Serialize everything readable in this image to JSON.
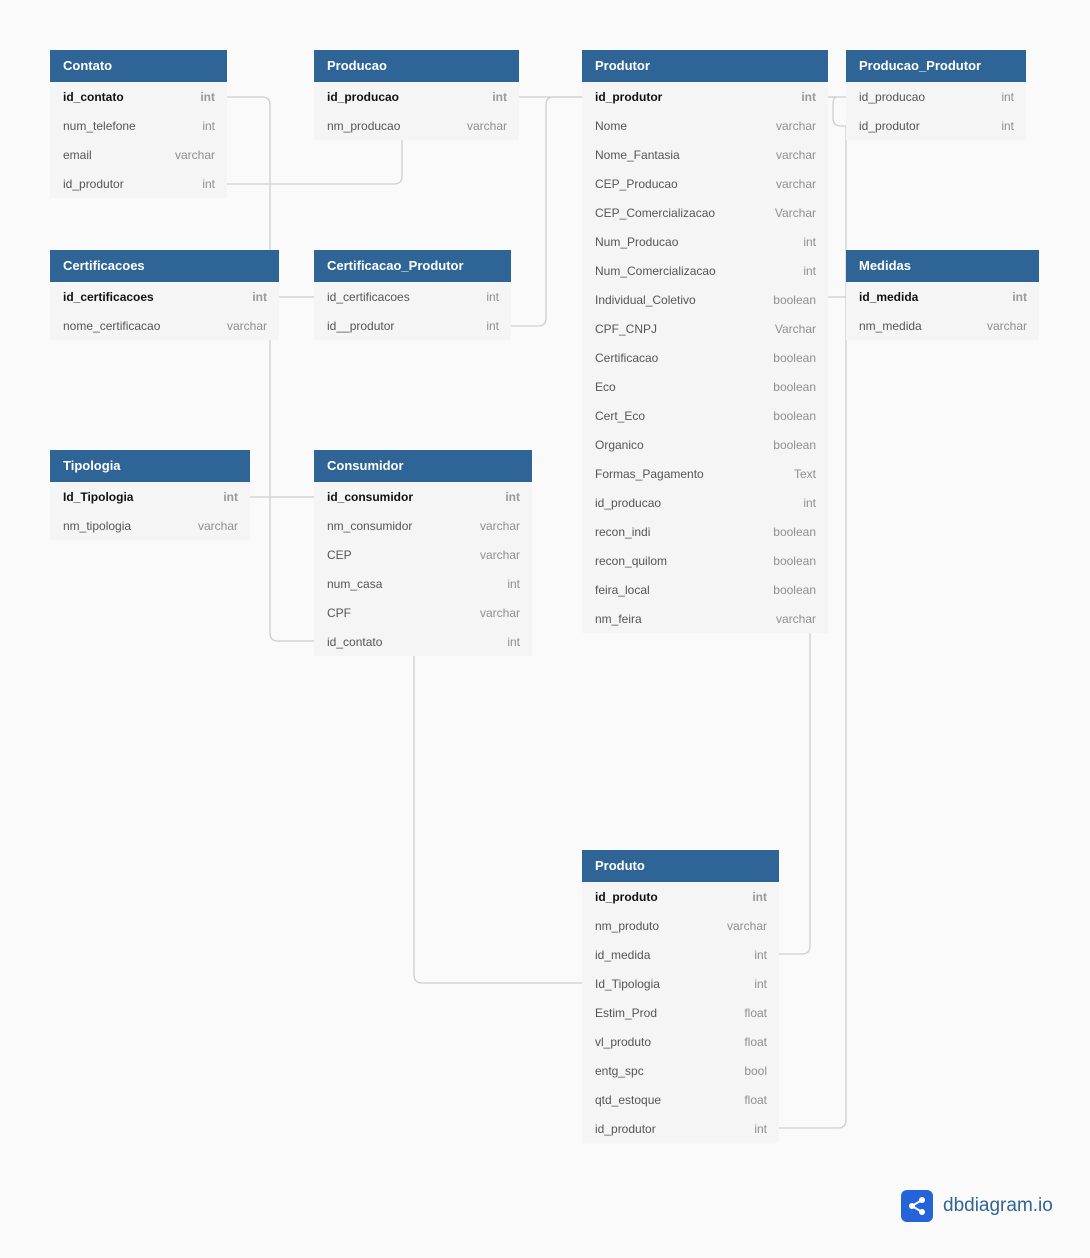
{
  "tables": [
    {
      "name": "Contato",
      "fields": [
        [
          "id_contato",
          "int",
          true
        ],
        [
          "num_telefone",
          "int",
          false
        ],
        [
          "email",
          "varchar",
          false
        ],
        [
          "id_produtor",
          "int",
          false
        ]
      ]
    },
    {
      "name": "Producao",
      "fields": [
        [
          "id_producao",
          "int",
          true
        ],
        [
          "nm_producao",
          "varchar",
          false
        ]
      ]
    },
    {
      "name": "Produtor",
      "fields": [
        [
          "id_produtor",
          "int",
          true
        ],
        [
          "Nome",
          "varchar",
          false
        ],
        [
          "Nome_Fantasia",
          "varchar",
          false
        ],
        [
          "CEP_Producao",
          "varchar",
          false
        ],
        [
          "CEP_Comercializacao",
          "Varchar",
          false
        ],
        [
          "Num_Producao",
          "int",
          false
        ],
        [
          "Num_Comercializacao",
          "int",
          false
        ],
        [
          "Individual_Coletivo",
          "boolean",
          false
        ],
        [
          "CPF_CNPJ",
          "Varchar",
          false
        ],
        [
          "Certificacao",
          "boolean",
          false
        ],
        [
          "Eco",
          "boolean",
          false
        ],
        [
          "Cert_Eco",
          "boolean",
          false
        ],
        [
          "Organico",
          "boolean",
          false
        ],
        [
          "Formas_Pagamento",
          "Text",
          false
        ],
        [
          "id_producao",
          "int",
          false
        ],
        [
          "recon_indi",
          "boolean",
          false
        ],
        [
          "recon_quilom",
          "boolean",
          false
        ],
        [
          "feira_local",
          "boolean",
          false
        ],
        [
          "nm_feira",
          "varchar",
          false
        ]
      ]
    },
    {
      "name": "Producao_Produtor",
      "fields": [
        [
          "id_producao",
          "int",
          false
        ],
        [
          "id_produtor",
          "int",
          false
        ]
      ]
    },
    {
      "name": "Certificacoes",
      "fields": [
        [
          "id_certificacoes",
          "int",
          true
        ],
        [
          "nome_certificacao",
          "varchar",
          false
        ]
      ]
    },
    {
      "name": "Certificacao_Produtor",
      "fields": [
        [
          "id_certificacoes",
          "int",
          false
        ],
        [
          "id__produtor",
          "int",
          false
        ]
      ]
    },
    {
      "name": "Medidas",
      "fields": [
        [
          "id_medida",
          "int",
          true
        ],
        [
          "nm_medida",
          "varchar",
          false
        ]
      ]
    },
    {
      "name": "Tipologia",
      "fields": [
        [
          "Id_Tipologia",
          "int",
          true
        ],
        [
          "nm_tipologia",
          "varchar",
          false
        ]
      ]
    },
    {
      "name": "Consumidor",
      "fields": [
        [
          "id_consumidor",
          "int",
          true
        ],
        [
          "nm_consumidor",
          "varchar",
          false
        ],
        [
          "CEP",
          "varchar",
          false
        ],
        [
          "num_casa",
          "int",
          false
        ],
        [
          "CPF",
          "varchar",
          false
        ],
        [
          "id_contato",
          "int",
          false
        ]
      ]
    },
    {
      "name": "Produto",
      "fields": [
        [
          "id_produto",
          "int",
          true
        ],
        [
          "nm_produto",
          "varchar",
          false
        ],
        [
          "id_medida",
          "int",
          false
        ],
        [
          "Id_Tipologia",
          "int",
          false
        ],
        [
          "Estim_Prod",
          "float",
          false
        ],
        [
          "vl_produto",
          "float",
          false
        ],
        [
          "entg_spc",
          "bool",
          false
        ],
        [
          "qtd_estoque",
          "float",
          false
        ],
        [
          "id_produtor",
          "int",
          false
        ]
      ]
    }
  ],
  "brand": {
    "name": "dbdiagram.io",
    "color": "#2563d9"
  },
  "colors": {
    "header": "#2f6496",
    "line": "#cfcfcf"
  }
}
